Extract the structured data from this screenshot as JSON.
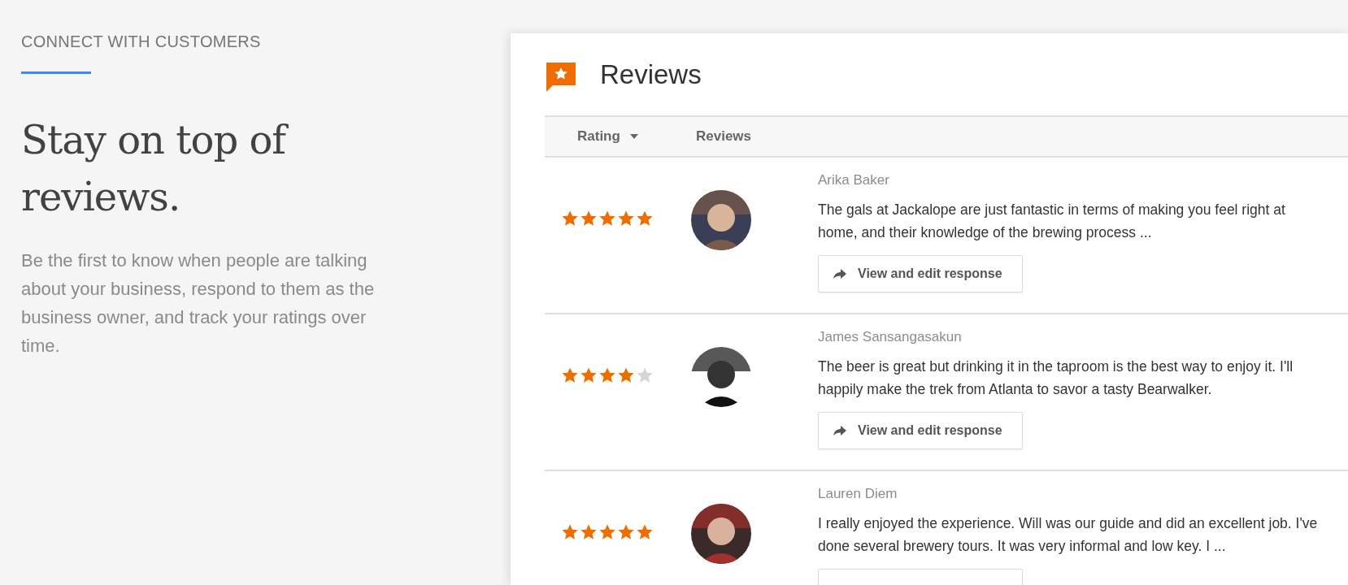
{
  "intro": {
    "eyebrow": "CONNECT WITH CUSTOMERS",
    "headline": "Stay on top of reviews.",
    "body": "Be the first to know when people are talking about your business, respond to them as the business owner, and track your ratings over time."
  },
  "card": {
    "title": "Reviews",
    "columns": [
      {
        "label": "Rating",
        "sortable": true
      },
      {
        "label": "Reviews",
        "sortable": false
      }
    ],
    "reviews": [
      {
        "stars": 5,
        "author": "Arika Baker",
        "text": "The gals at Jackalope are just fantastic in terms of making you feel right at home, and their knowledge of the brewing process ...",
        "response": {
          "label": "View and edit response"
        }
      },
      {
        "stars": 4,
        "author": "James Sansangasakun",
        "text": "The beer is great but drinking it in the taproom is the best way to enjoy it. I'll happily make the trek from Atlanta to savor a tasty Bearwalker.",
        "response": {
          "label": "View and edit response"
        }
      },
      {
        "stars": 5,
        "author": "Lauren Diem",
        "text": "I really enjoyed the experience. Will was our guide and did an excellent job. I've done several brewery tours. It was very informal and low key. I ...",
        "response": {
          "cut_off": true
        }
      }
    ]
  }
}
